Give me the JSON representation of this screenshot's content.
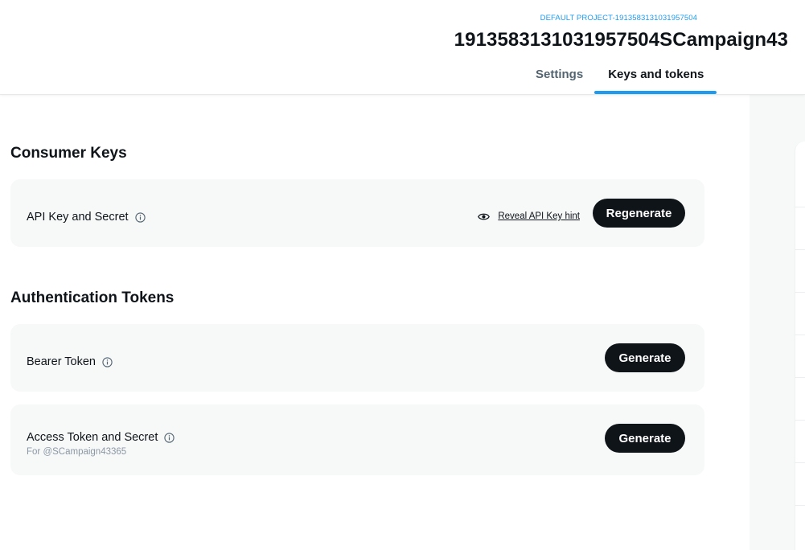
{
  "header": {
    "project_link": "DEFAULT PROJECT-1913583131031957504",
    "app_title": "1913583131031957504SCampaign43",
    "tabs": [
      {
        "label": "Settings",
        "active": false
      },
      {
        "label": "Keys and tokens",
        "active": true
      }
    ]
  },
  "consumer_keys": {
    "section_title": "Consumer Keys",
    "api_key": {
      "label": "API Key and Secret",
      "info_icon": "info-icon",
      "reveal_icon": "eye-icon",
      "reveal_label": "Reveal API Key hint",
      "button_label": "Regenerate"
    }
  },
  "auth_tokens": {
    "section_title": "Authentication Tokens",
    "bearer": {
      "label": "Bearer Token",
      "info_icon": "info-icon",
      "button_label": "Generate"
    },
    "access": {
      "label": "Access Token and Secret",
      "info_icon": "info-icon",
      "sub_label": "For @SCampaign43365",
      "button_label": "Generate"
    }
  },
  "colors": {
    "accent": "#1d9bf0",
    "button_bg": "#0f1419",
    "card_bg": "#f7f8f8",
    "muted_text": "#8b98a5"
  }
}
